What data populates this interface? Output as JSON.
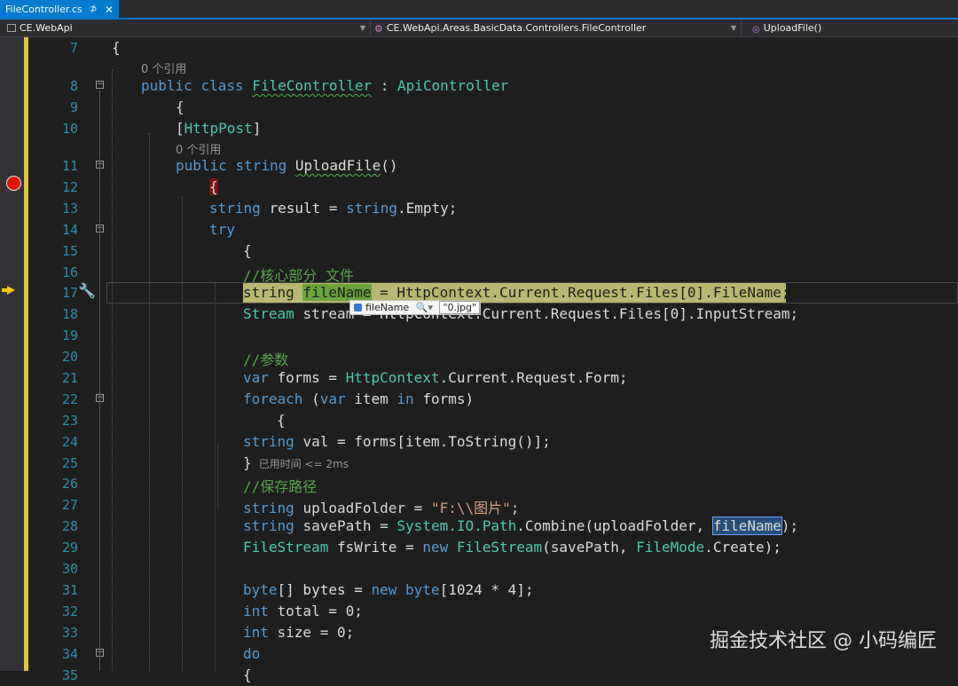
{
  "tab": {
    "title": "FileController.cs",
    "pin": "⊅",
    "close": "✕"
  },
  "navbar": {
    "project": "CE.WebApi",
    "type": "CE.WebApi.Areas.BasicData.Controllers.FileController",
    "member": "UploadFile()"
  },
  "editor": {
    "lines": [
      {
        "num": "7",
        "fold": false,
        "code": [
          [
            "p",
            "{"
          ]
        ]
      },
      {
        "lens": "0 个引用"
      },
      {
        "num": "8",
        "fold": true,
        "code": [
          [
            "k",
            "public "
          ],
          [
            "k",
            "class "
          ],
          [
            "t squig",
            "FileController"
          ],
          [
            "p",
            " : "
          ],
          [
            "t",
            "ApiController"
          ]
        ]
      },
      {
        "num": "9",
        "fold": false,
        "code": [
          [
            "p",
            "{"
          ]
        ]
      },
      {
        "num": "10",
        "fold": false,
        "code": [
          [
            "p",
            "["
          ],
          [
            "attr",
            "HttpPost"
          ],
          [
            "p",
            "]"
          ]
        ]
      },
      {
        "lens": "0 个引用"
      },
      {
        "num": "11",
        "fold": true,
        "code": [
          [
            "k",
            "public "
          ],
          [
            "k",
            "string "
          ],
          [
            "p squig",
            "UploadFile"
          ],
          [
            "p",
            "()"
          ]
        ]
      },
      {
        "num": "12",
        "fold": false,
        "code": [
          [
            "brace",
            "{"
          ]
        ]
      },
      {
        "num": "13",
        "fold": false,
        "code": [
          [
            "k",
            "string "
          ],
          [
            "p",
            "result = "
          ],
          [
            "k",
            "string"
          ],
          [
            "p",
            ".Empty;"
          ]
        ]
      },
      {
        "num": "14",
        "fold": true,
        "code": [
          [
            "k",
            "try"
          ]
        ]
      },
      {
        "num": "15",
        "fold": false,
        "code": [
          [
            "p",
            "{"
          ]
        ]
      },
      {
        "num": "16",
        "fold": false,
        "code": [
          [
            "c",
            "//核心部分 文件"
          ]
        ]
      },
      {
        "num": "17",
        "fold": false,
        "code": [
          [
            "x",
            "string "
          ],
          [
            "name",
            "fileName"
          ],
          [
            "x",
            " = HttpContext.Current.Request.Files[0].FileName;"
          ]
        ]
      },
      {
        "num": "18",
        "fold": false,
        "code": [
          [
            "t",
            "Stream "
          ],
          [
            "p",
            "stream = HttpContext.Current.Request.Files[0].InputStream;"
          ]
        ]
      },
      {
        "num": "19",
        "fold": false,
        "code": []
      },
      {
        "num": "20",
        "fold": false,
        "code": [
          [
            "c",
            "//参数"
          ]
        ]
      },
      {
        "num": "21",
        "fold": false,
        "code": [
          [
            "k",
            "var "
          ],
          [
            "p",
            "forms = "
          ],
          [
            "t",
            "HttpContext"
          ],
          [
            "p",
            ".Current.Request.Form;"
          ]
        ]
      },
      {
        "num": "22",
        "fold": true,
        "code": [
          [
            "k",
            "foreach "
          ],
          [
            "p",
            "("
          ],
          [
            "k",
            "var "
          ],
          [
            "p",
            "item "
          ],
          [
            "k",
            "in "
          ],
          [
            "p",
            "forms)"
          ]
        ]
      },
      {
        "num": "23",
        "fold": false,
        "code": [
          [
            "p",
            "{"
          ]
        ]
      },
      {
        "num": "24",
        "fold": false,
        "code": [
          [
            "k",
            "string "
          ],
          [
            "p",
            "val = forms[item.ToString()];"
          ]
        ]
      },
      {
        "num": "25",
        "fold": false,
        "code": [
          [
            "p",
            "}"
          ]
        ],
        "elapsed": "已用时间 <= 2ms"
      },
      {
        "num": "26",
        "fold": false,
        "code": [
          [
            "c",
            "//保存路径"
          ]
        ]
      },
      {
        "num": "27",
        "fold": false,
        "code": [
          [
            "k",
            "string "
          ],
          [
            "p",
            "uploadFolder = "
          ],
          [
            "s",
            "\"F:\\\\图片\""
          ],
          [
            "p",
            ";"
          ]
        ]
      },
      {
        "num": "28",
        "fold": false,
        "code": [
          [
            "k",
            "string "
          ],
          [
            "p",
            "savePath = "
          ],
          [
            "t",
            "System.IO.Path"
          ],
          [
            "p",
            ".Combine(uploadFolder, "
          ],
          [
            "ref",
            "fileName"
          ],
          [
            "p",
            ");"
          ]
        ]
      },
      {
        "num": "29",
        "fold": false,
        "code": [
          [
            "t",
            "FileStream "
          ],
          [
            "p",
            "fsWrite = "
          ],
          [
            "k",
            "new "
          ],
          [
            "t",
            "FileStream"
          ],
          [
            "p",
            "(savePath, "
          ],
          [
            "t",
            "FileMode"
          ],
          [
            "p",
            ".Create);"
          ]
        ]
      },
      {
        "num": "30",
        "fold": false,
        "code": []
      },
      {
        "num": "31",
        "fold": false,
        "code": [
          [
            "k",
            "byte"
          ],
          [
            "p",
            "[] bytes = "
          ],
          [
            "k",
            "new "
          ],
          [
            "k",
            "byte"
          ],
          [
            "p",
            "[1024 * 4];"
          ]
        ]
      },
      {
        "num": "32",
        "fold": false,
        "code": [
          [
            "k",
            "int "
          ],
          [
            "p",
            "total = 0;"
          ]
        ]
      },
      {
        "num": "33",
        "fold": false,
        "code": [
          [
            "k",
            "int "
          ],
          [
            "p",
            "size = 0;"
          ]
        ]
      },
      {
        "num": "34",
        "fold": true,
        "code": [
          [
            "k",
            "do"
          ]
        ]
      },
      {
        "num": "35",
        "fold": false,
        "code": [
          [
            "p",
            "{"
          ]
        ]
      }
    ]
  },
  "datatip": {
    "name": "fileName",
    "value": "\"0.jpg\""
  },
  "watermark": "掘金技术社区 @ 小码编匠"
}
